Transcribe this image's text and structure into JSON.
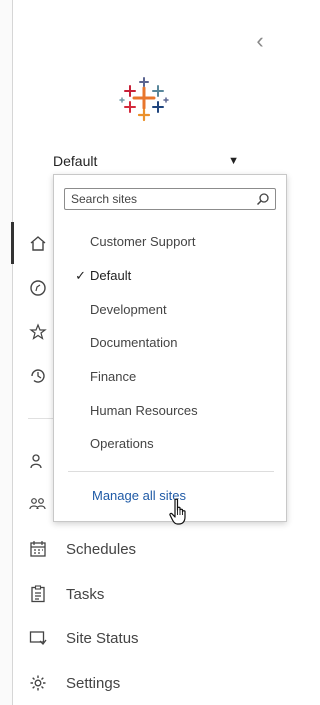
{
  "header": {
    "collapse_icon": "chevron-left-icon",
    "logo": "tableau-logo"
  },
  "site_switcher": {
    "current_site": "Default",
    "caret_icon": "caret-down-icon"
  },
  "dropdown": {
    "search_placeholder": "Search sites",
    "search_icon": "search-icon",
    "sites": [
      {
        "label": "Customer Support",
        "selected": false
      },
      {
        "label": "Default",
        "selected": true
      },
      {
        "label": "Development",
        "selected": false
      },
      {
        "label": "Documentation",
        "selected": false
      },
      {
        "label": "Finance",
        "selected": false
      },
      {
        "label": "Human Resources",
        "selected": false
      },
      {
        "label": "Operations",
        "selected": false
      }
    ],
    "check_mark": "✓",
    "manage_label": "Manage all sites"
  },
  "nav": {
    "schedules": "Schedules",
    "tasks": "Tasks",
    "site_status": "Site Status",
    "settings": "Settings"
  },
  "colors": {
    "link": "#1f5aa6",
    "active_bar": "#333333"
  }
}
